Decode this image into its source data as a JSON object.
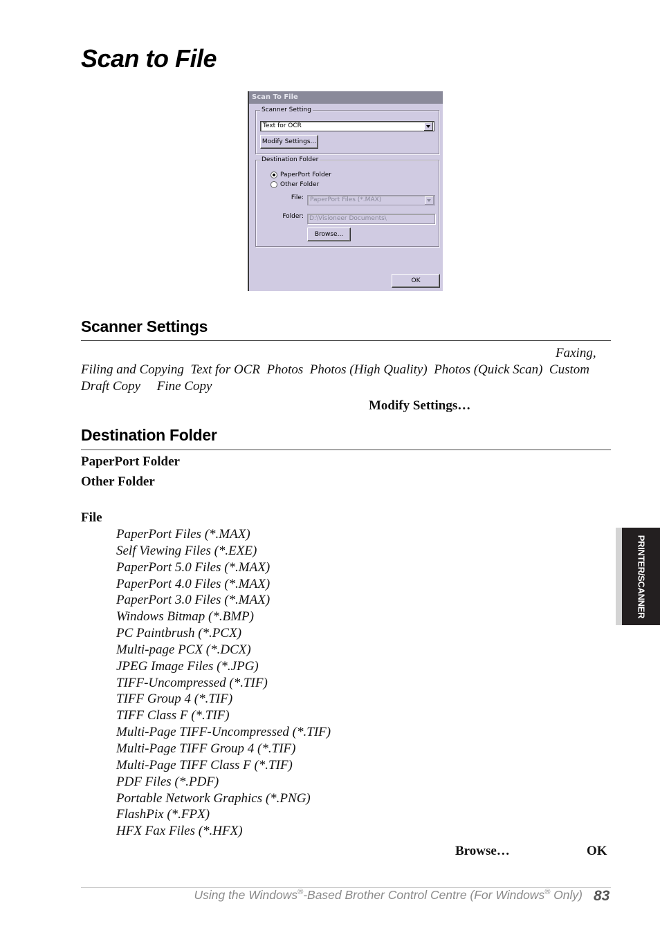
{
  "page": {
    "title": "Scan to File",
    "page_number": "83",
    "side_tab": "PRINTER/SCANNER",
    "footer": {
      "part1": "Using the Windows",
      "reg1": "®",
      "part2": "-Based Brother Control Centre (For Windows",
      "reg2": "®",
      "part3": " Only)"
    }
  },
  "dialog": {
    "title": "Scan To File",
    "scanner_setting_group": "Scanner Setting",
    "scanner_setting_value": "Text for OCR",
    "modify_settings_button": "Modify Settings...",
    "destination_group": "Destination Folder",
    "radio_paperport": "PaperPort Folder",
    "radio_other": "Other Folder",
    "selected_radio": "PaperPort Folder",
    "file_label": "File:",
    "file_value": "PaperPort Files (*.MAX)",
    "folder_label": "Folder:",
    "folder_value": "D:\\Visioneer Documents\\",
    "browse_button": "Browse...",
    "ok_button": "OK"
  },
  "scanner_settings": {
    "heading": "Scanner Settings",
    "line1_end": "Faxing,",
    "line2": [
      "Filing and Copying",
      "Text for OCR",
      "Photos",
      "Photos (High Quality)",
      "Photos (Quick Scan)",
      "Custom"
    ],
    "line3": [
      "Draft Copy",
      "Fine Copy"
    ],
    "modify_label": "Modify Settings…"
  },
  "destination_folder": {
    "heading": "Destination Folder",
    "paperport_label": "PaperPort Folder",
    "other_label": "Other Folder",
    "file_label": "File",
    "file_formats": [
      "PaperPort Files (*.MAX)",
      "Self Viewing Files (*.EXE)",
      "PaperPort 5.0 Files (*.MAX)",
      "PaperPort 4.0 Files (*.MAX)",
      "PaperPort 3.0 Files (*.MAX)",
      "Windows Bitmap (*.BMP)",
      "PC Paintbrush (*.PCX)",
      "Multi-page PCX (*.DCX)",
      "JPEG Image Files (*.JPG)",
      "TIFF-Uncompressed (*.TIF)",
      "TIFF Group 4 (*.TIF)",
      "TIFF Class F (*.TIF)",
      "Multi-Page TIFF-Uncompressed (*.TIF)",
      "Multi-Page TIFF Group 4 (*.TIF)",
      "Multi-Page TIFF Class F (*.TIF)",
      "PDF Files (*.PDF)",
      "Portable Network Graphics (*.PNG)",
      "FlashPix (*.FPX)",
      "HFX Fax Files (*.HFX)"
    ],
    "browse_label": "Browse…",
    "ok_label": "OK"
  }
}
